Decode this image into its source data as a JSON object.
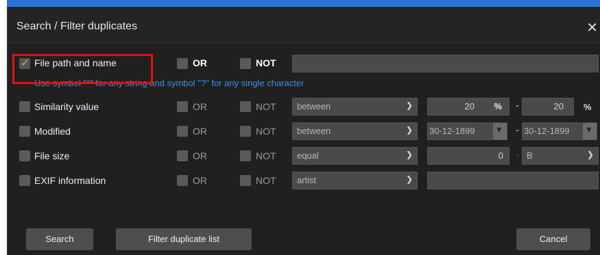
{
  "dialog": {
    "title": "Search / Filter duplicates",
    "close_glyph": "✕"
  },
  "rows": {
    "file_path": {
      "label": "File path and name",
      "checked": true,
      "or": "OR",
      "not": "NOT",
      "value": ""
    },
    "hint": "Use symbol \"*\" for any string and symbol \"?\" for any single character",
    "similarity": {
      "label": "Similarity value",
      "or": "OR",
      "not": "NOT",
      "op": "between",
      "from": "20",
      "from_unit": "%",
      "to": "20",
      "to_unit": "%",
      "sep": "-"
    },
    "modified": {
      "label": "Modified",
      "or": "OR",
      "not": "NOT",
      "op": "between",
      "from": "30-12-1899",
      "to": "30-12-1899",
      "sep": "-"
    },
    "file_size": {
      "label": "File size",
      "or": "OR",
      "not": "NOT",
      "op": "equal",
      "value": "0",
      "unit": "B",
      "sep": "-"
    },
    "exif": {
      "label": "EXIF information",
      "or": "OR",
      "not": "NOT",
      "op": "artist",
      "value": ""
    }
  },
  "buttons": {
    "search": "Search",
    "filter": "Filter duplicate list",
    "cancel": "Cancel"
  },
  "icons": {
    "chevron": "chevron-down-icon",
    "calendar": "calendar-dropdown-icon"
  },
  "colors": {
    "highlight": "#e01010",
    "hint": "#3a8ee6",
    "checkmark": "#f0a020",
    "titlebar_accent": "#2f6fd8"
  }
}
